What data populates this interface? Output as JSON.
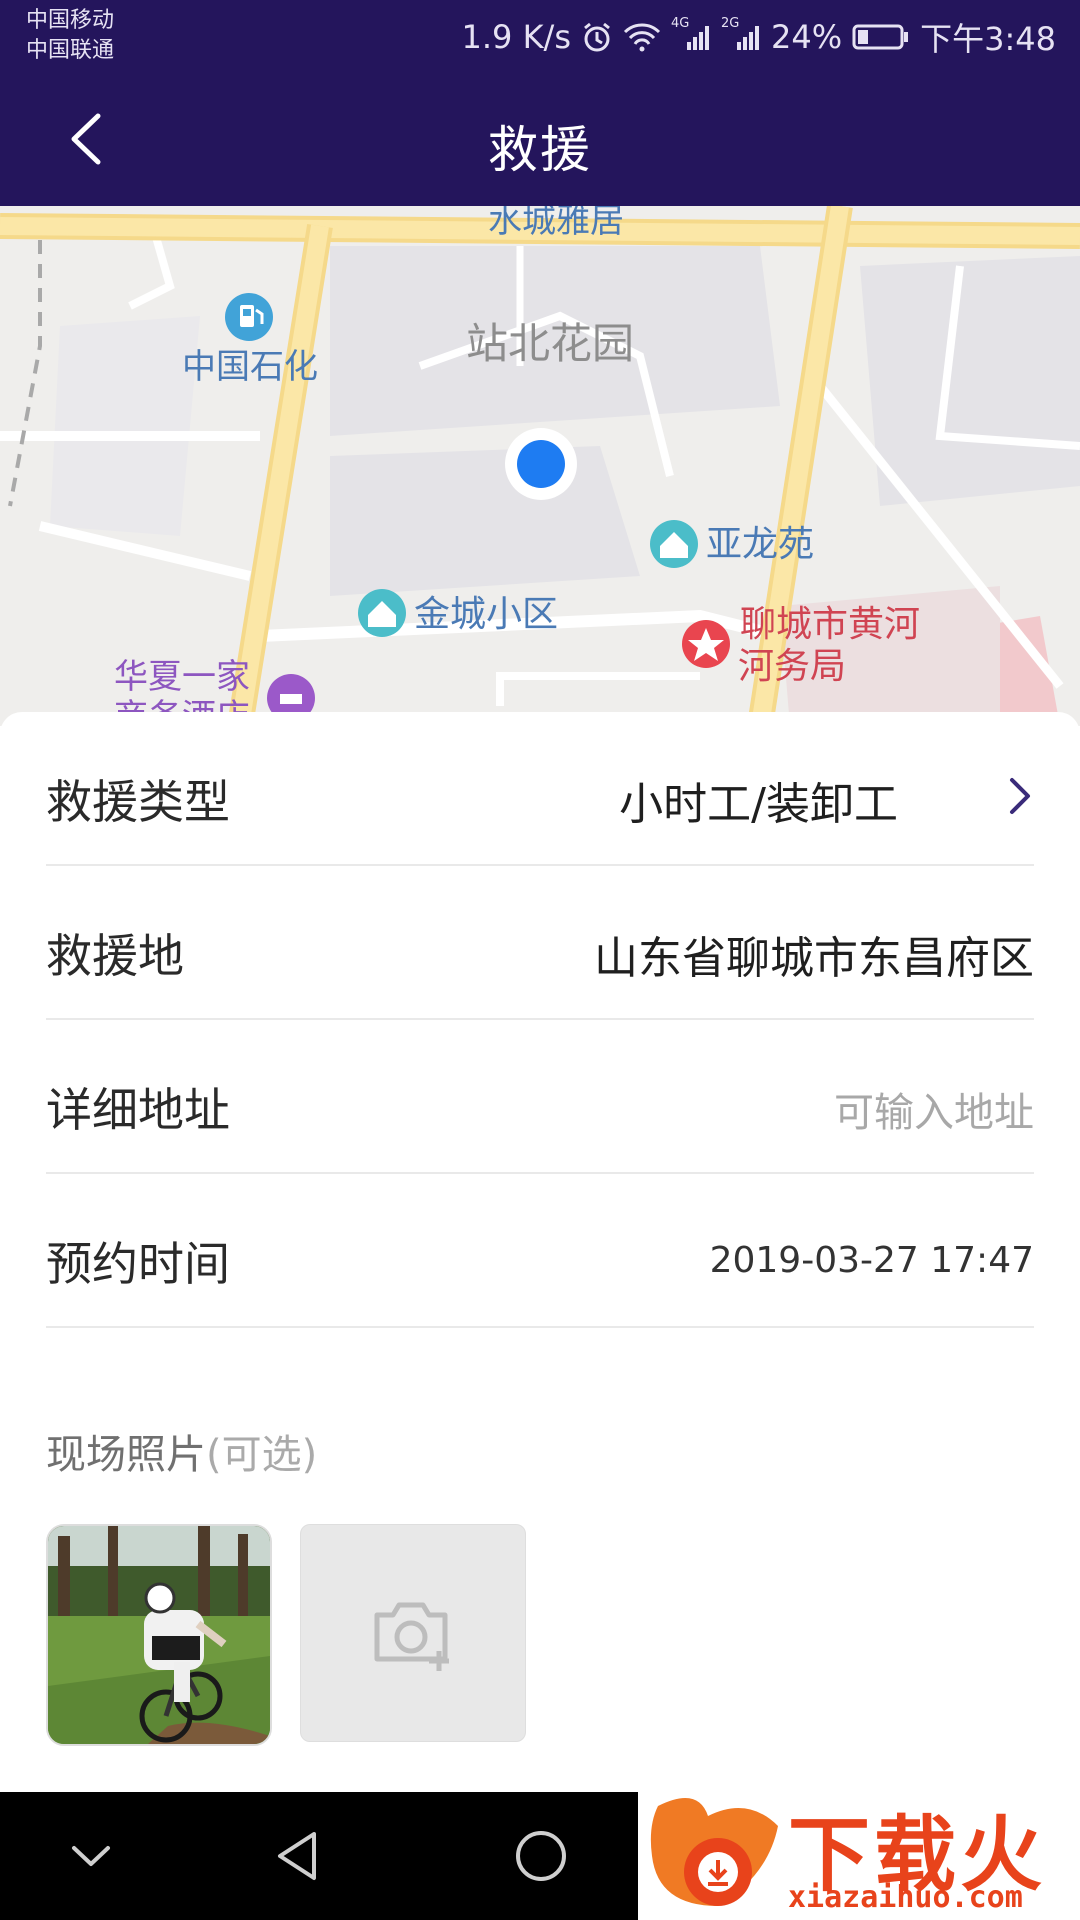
{
  "status_bar": {
    "carrier_1": "中国移动",
    "carrier_2": "中国联通",
    "net_speed": "1.9 K/s",
    "net_4g": "4G",
    "net_2g": "2G",
    "battery": "24%",
    "time": "下午3:48"
  },
  "header": {
    "title": "救援"
  },
  "map": {
    "labels": [
      "水城雅居",
      "站北花园",
      "中国石化",
      "亚龙苑",
      "金城小区",
      "聊城市黄河",
      "河务局",
      "华夏一家",
      "商务酒店"
    ]
  },
  "form": {
    "rescue_type_label": "救援类型",
    "rescue_type_value": "小时工/装卸工",
    "rescue_place_label": "救援地",
    "rescue_place_value": "山东省聊城市东昌府区",
    "detail_address_label": "详细地址",
    "detail_address_placeholder": "可输入地址",
    "appointment_label": "预约时间",
    "appointment_value": "2019-03-27 17:47",
    "photos_label": "现场照片",
    "photos_optional": "(可选)"
  },
  "watermark": {
    "text": "下载火",
    "url": "xiazaihuo.com"
  },
  "colors": {
    "header_bg": "#24155c",
    "accent": "#24155c",
    "location_dot": "#1e7cf2"
  },
  "icons": [
    "back-arrow-icon",
    "chevron-right-icon",
    "camera-add-icon",
    "location-dot-icon",
    "gas-station-icon",
    "residence-icon",
    "government-icon",
    "hotel-icon",
    "nav-down-icon",
    "nav-back-icon",
    "nav-home-icon"
  ]
}
